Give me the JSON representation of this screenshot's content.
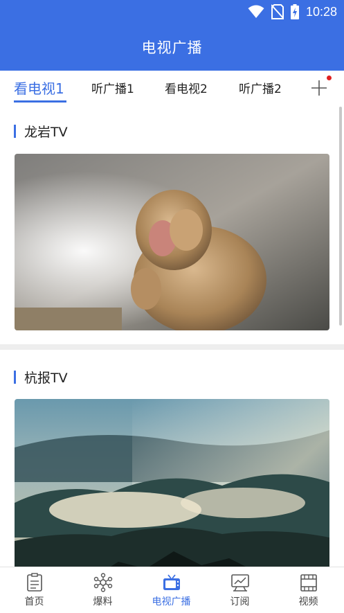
{
  "status": {
    "time": "10:28"
  },
  "header": {
    "title": "电视广播"
  },
  "tabs": [
    {
      "label": "看电视1"
    },
    {
      "label": "听广播1"
    },
    {
      "label": "看电视2"
    },
    {
      "label": "听广播2"
    }
  ],
  "sections": [
    {
      "title": "龙岩TV"
    },
    {
      "title": "杭报TV"
    }
  ],
  "nav": [
    {
      "label": "首页",
      "icon": "clipboard-icon"
    },
    {
      "label": "爆料",
      "icon": "share-network-icon"
    },
    {
      "label": "电视广播",
      "icon": "tv-icon"
    },
    {
      "label": "订阅",
      "icon": "chart-board-icon"
    },
    {
      "label": "视频",
      "icon": "film-strip-icon"
    }
  ],
  "colors": {
    "accent": "#3b6fe3",
    "badge": "#e02020"
  }
}
